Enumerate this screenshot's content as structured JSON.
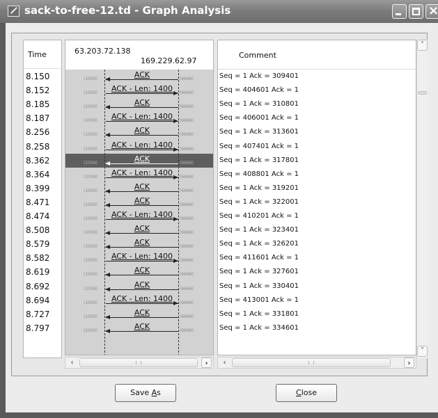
{
  "window": {
    "title": "sack-to-free-12.td - Graph Analysis"
  },
  "header": {
    "time_label": "Time",
    "ip_left": "63.203.72.138",
    "ip_right": "169.229.62.97",
    "comment_label": "Comment"
  },
  "ports": {
    "left": "(1059)",
    "right": "(6666)"
  },
  "rows": [
    {
      "time": "8.150",
      "label": "ACK",
      "direction": "left",
      "comment": "Seq = 1 Ack = 309401"
    },
    {
      "time": "8.152",
      "label": "ACK - Len: 1400",
      "direction": "right",
      "comment": "Seq = 404601 Ack = 1"
    },
    {
      "time": "8.185",
      "label": "ACK",
      "direction": "left",
      "comment": "Seq = 1 Ack = 310801"
    },
    {
      "time": "8.187",
      "label": "ACK - Len: 1400",
      "direction": "right",
      "comment": "Seq = 406001 Ack = 1"
    },
    {
      "time": "8.256",
      "label": "ACK",
      "direction": "left",
      "comment": "Seq = 1 Ack = 313601"
    },
    {
      "time": "8.258",
      "label": "ACK - Len: 1400",
      "direction": "right",
      "comment": "Seq = 407401 Ack = 1"
    },
    {
      "time": "8.362",
      "label": "ACK",
      "direction": "left",
      "comment": "Seq = 1 Ack = 317801",
      "selected": true
    },
    {
      "time": "8.364",
      "label": "ACK - Len: 1400",
      "direction": "right",
      "comment": "Seq = 408801 Ack = 1"
    },
    {
      "time": "8.399",
      "label": "ACK",
      "direction": "left",
      "comment": "Seq = 1 Ack = 319201"
    },
    {
      "time": "8.471",
      "label": "ACK",
      "direction": "left",
      "comment": "Seq = 1 Ack = 322001"
    },
    {
      "time": "8.474",
      "label": "ACK - Len: 1400",
      "direction": "right",
      "comment": "Seq = 410201 Ack = 1"
    },
    {
      "time": "8.508",
      "label": "ACK",
      "direction": "left",
      "comment": "Seq = 1 Ack = 323401"
    },
    {
      "time": "8.579",
      "label": "ACK",
      "direction": "left",
      "comment": "Seq = 1 Ack = 326201"
    },
    {
      "time": "8.582",
      "label": "ACK - Len: 1400",
      "direction": "right",
      "comment": "Seq = 411601 Ack = 1"
    },
    {
      "time": "8.619",
      "label": "ACK",
      "direction": "left",
      "comment": "Seq = 1 Ack = 327601"
    },
    {
      "time": "8.692",
      "label": "ACK",
      "direction": "left",
      "comment": "Seq = 1 Ack = 330401"
    },
    {
      "time": "8.694",
      "label": "ACK - Len: 1400",
      "direction": "right",
      "comment": "Seq = 413001 Ack = 1"
    },
    {
      "time": "8.727",
      "label": "ACK",
      "direction": "left",
      "comment": "Seq = 1 Ack = 331801"
    },
    {
      "time": "8.797",
      "label": "ACK",
      "direction": "left",
      "comment": "Seq = 1 Ack = 334601"
    }
  ],
  "buttons": {
    "save_as": "Save As",
    "save_as_mnemonic": "A",
    "close": "Close",
    "close_mnemonic": "C"
  },
  "colors": {
    "selected_row": "#5e5e5e",
    "graph_background": "#d2d2d2"
  }
}
